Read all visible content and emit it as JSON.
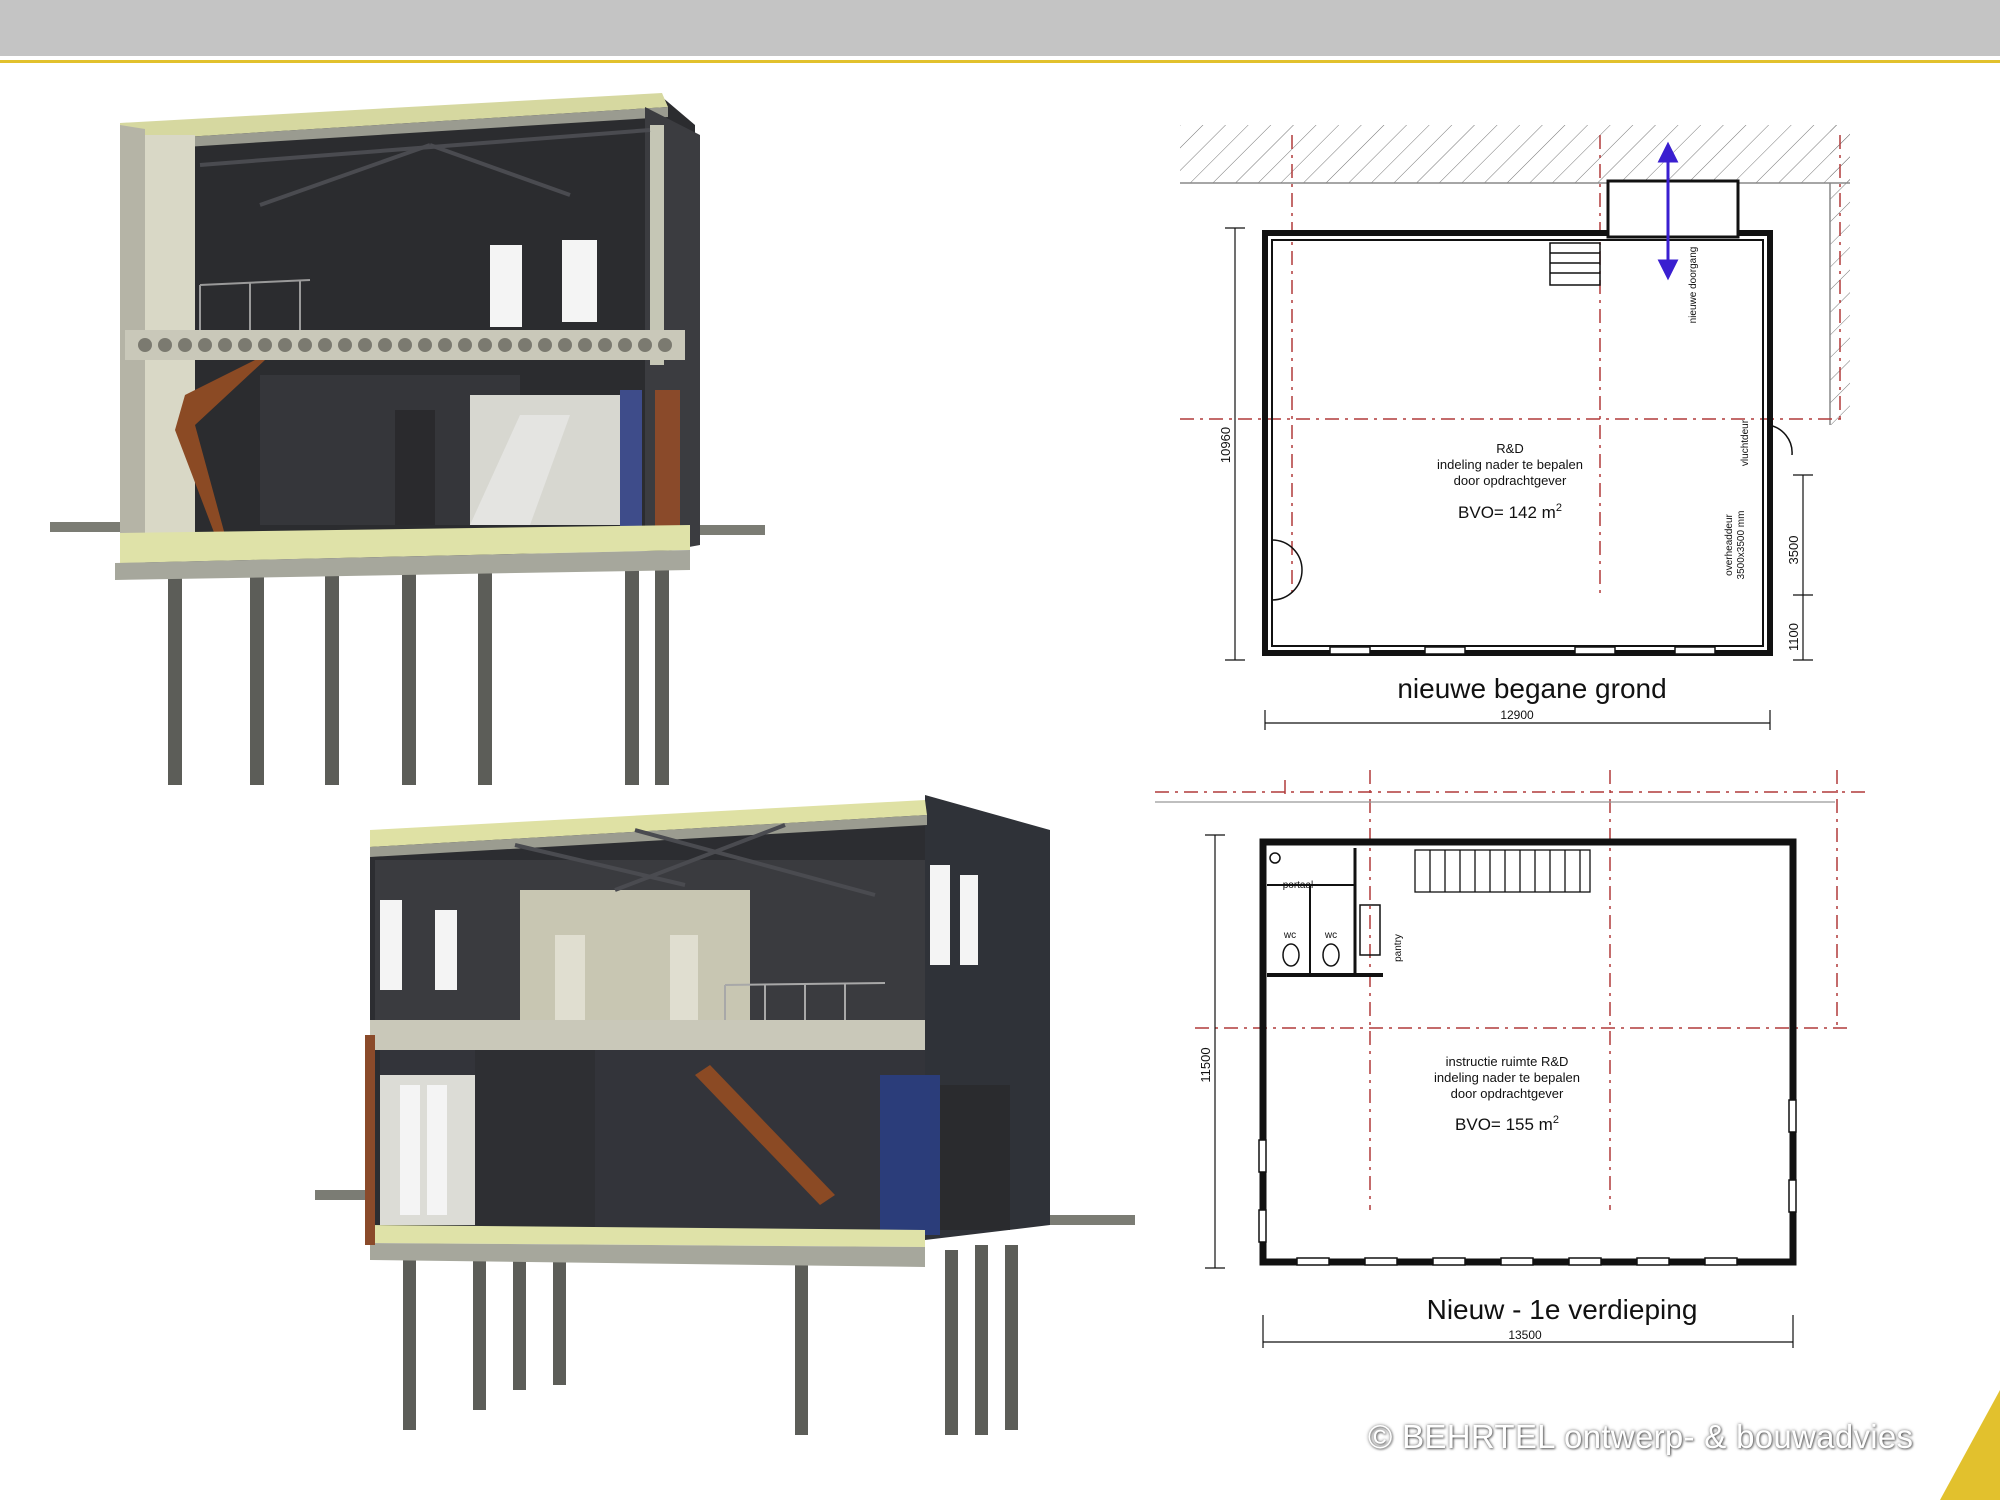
{
  "colors": {
    "accent_line": "#e2c12d",
    "header_bar": "#c4c4c4",
    "grid_line": "#b03a3a",
    "arrow": "#3a1fd0",
    "render_dark": "#2a2b2e",
    "render_concrete": "#b9b8a8",
    "render_insulation": "#e3e6b0",
    "render_brick": "#8a4a2a"
  },
  "renders": [
    {
      "name": "section-render-ground-floor-view",
      "description_icon": "building-section-render"
    },
    {
      "name": "section-render-first-floor-view",
      "description_icon": "building-section-render"
    }
  ],
  "plan_ground": {
    "title": "nieuwe begane grond",
    "room_name": "R&D",
    "room_line1": "indeling nader te bepalen",
    "room_line2": "door opdrachtgever",
    "area_prefix": "BVO= 142 m",
    "area_sup": "2",
    "dim_width": "12900",
    "dim_height": "10960",
    "dim_door": "3500",
    "dim_sill": "1100",
    "label_new_entrance": "nieuwe doorgang",
    "label_escape_door": "vluchtdeur",
    "label_overhead_door": "overheaddeur",
    "label_overhead_size": "3500x3500 mm"
  },
  "plan_first": {
    "title": "Nieuw - 1e verdieping",
    "room_name": "instructie ruimte R&D",
    "room_line1": "indeling nader te bepalen",
    "room_line2": "door opdrachtgever",
    "area_prefix": "BVO= 155 m",
    "area_sup": "2",
    "dim_width": "13500",
    "dim_height": "11500",
    "label_portal": "portaal",
    "label_wc1": "wc",
    "label_wc2": "wc",
    "label_pantry": "pantry"
  },
  "watermark": "© BEHRTEL ontwerp- & bouwadvies"
}
